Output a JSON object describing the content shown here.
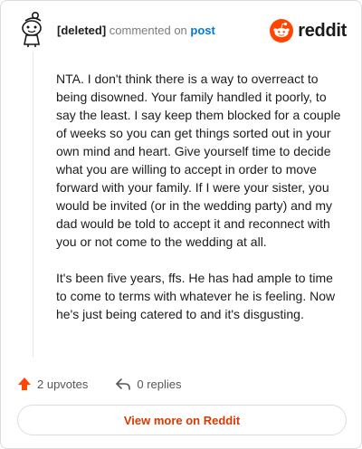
{
  "comment": {
    "author": "[deleted]",
    "action_text": "commented on",
    "post_link": "post",
    "paragraphs": [
      "NTA. I don't think there is a way to overreact to being disowned. Your family handled it poorly, to say the least. I say keep them blocked for a couple of weeks so you can get things sorted out in your own mind and heart. Give yourself time to decide what you are willing to accept in order to move forward with your family. If I were your sister, you would be invited (or in the wedding party) and my dad would be told to accept it and reconnect with you or not come to the wedding at all.",
      "It's been five years, ffs. He has had ample to time to come to terms with whatever he is feeling. Now he's just being catered to and it's disgusting."
    ]
  },
  "brand": {
    "name": "reddit",
    "icon": "reddit-snoo-icon",
    "color": "#ff4500"
  },
  "actions": {
    "upvotes_label": "2 upvotes",
    "replies_label": "0 replies",
    "upvote_icon": "upvote-arrow-icon",
    "reply_icon": "reply-arrow-icon",
    "upvote_color": "#ff4500"
  },
  "footer": {
    "view_more_label": "View more on Reddit",
    "accent": "#d93a00"
  }
}
